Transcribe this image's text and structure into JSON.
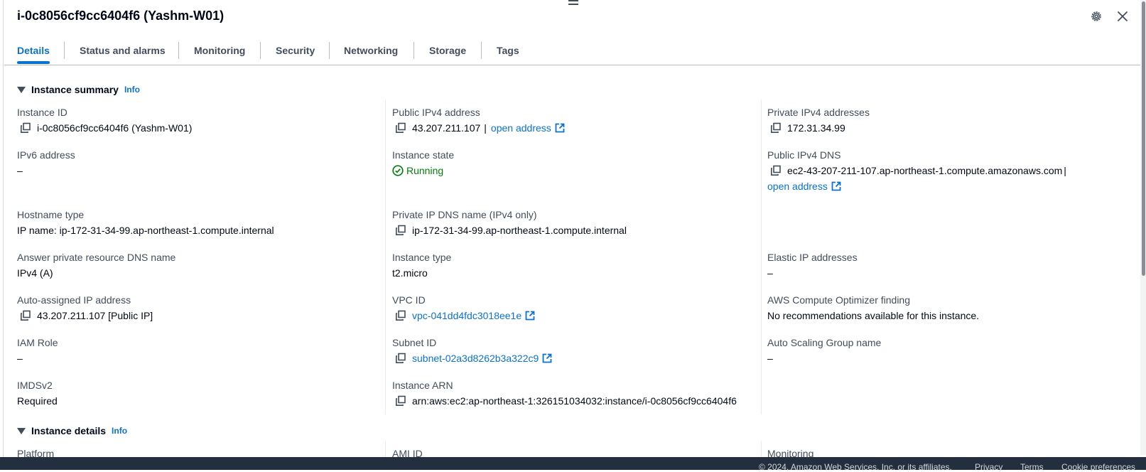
{
  "header": {
    "title": "i-0c8056cf9cc6404f6 (Yashm-W01)"
  },
  "tabs": [
    {
      "label": "Details",
      "active": true
    },
    {
      "label": "Status and alarms"
    },
    {
      "label": "Monitoring"
    },
    {
      "label": "Security"
    },
    {
      "label": "Networking"
    },
    {
      "label": "Storage"
    },
    {
      "label": "Tags"
    }
  ],
  "summary": {
    "title": "Instance summary",
    "info": "Info",
    "instance_id": {
      "label": "Instance ID",
      "value": "i-0c8056cf9cc6404f6 (Yashm-W01)"
    },
    "public_ipv4": {
      "label": "Public IPv4 address",
      "value": "43.207.211.107",
      "sep": "|",
      "link": "open address"
    },
    "private_ipv4": {
      "label": "Private IPv4 addresses",
      "value": "172.31.34.99"
    },
    "ipv6": {
      "label": "IPv6 address",
      "value": "–"
    },
    "state": {
      "label": "Instance state",
      "value": "Running"
    },
    "public_dns": {
      "label": "Public IPv4 DNS",
      "value": "ec2-43-207-211-107.ap-northeast-1.compute.amazonaws.com",
      "sep": "|",
      "link": "open address"
    },
    "hostname_type": {
      "label": "Hostname type",
      "value": "IP name: ip-172-31-34-99.ap-northeast-1.compute.internal"
    },
    "private_dns": {
      "label": "Private IP DNS name (IPv4 only)",
      "value": "ip-172-31-34-99.ap-northeast-1.compute.internal"
    },
    "answer_dns": {
      "label": "Answer private resource DNS name",
      "value": "IPv4 (A)"
    },
    "instance_type": {
      "label": "Instance type",
      "value": "t2.micro"
    },
    "elastic_ip": {
      "label": "Elastic IP addresses",
      "value": "–"
    },
    "auto_ip": {
      "label": "Auto-assigned IP address",
      "value": "43.207.211.107 [Public IP]"
    },
    "vpc": {
      "label": "VPC ID",
      "value": "vpc-041dd4fdc3018ee1e"
    },
    "optimizer": {
      "label": "AWS Compute Optimizer finding",
      "value": "No recommendations available for this instance."
    },
    "iam_role": {
      "label": "IAM Role",
      "value": "–"
    },
    "subnet": {
      "label": "Subnet ID",
      "value": "subnet-02a3d8262b3a322c9"
    },
    "asg": {
      "label": "Auto Scaling Group name",
      "value": "–"
    },
    "imdsv2": {
      "label": "IMDSv2",
      "value": "Required"
    },
    "arn": {
      "label": "Instance ARN",
      "value": "arn:aws:ec2:ap-northeast-1:326151034032:instance/i-0c8056cf9cc6404f6"
    }
  },
  "details": {
    "title": "Instance details",
    "info": "Info",
    "platform_label": "Platform",
    "ami_label": "AMI ID",
    "monitoring_label": "Monitoring"
  },
  "footer": {
    "copyright": "© 2024, Amazon Web Services, Inc. or its affiliates.",
    "privacy": "Privacy",
    "terms": "Terms",
    "cookies": "Cookie preferences"
  },
  "colors": {
    "link": "#0972d3",
    "running": "#037f0c",
    "footer_bg": "#232f3e"
  },
  "icons": [
    "copy-icon",
    "external-link-icon",
    "check-circle-icon",
    "gear-icon",
    "close-icon",
    "caret-down-icon",
    "drag-handle-icon"
  ]
}
